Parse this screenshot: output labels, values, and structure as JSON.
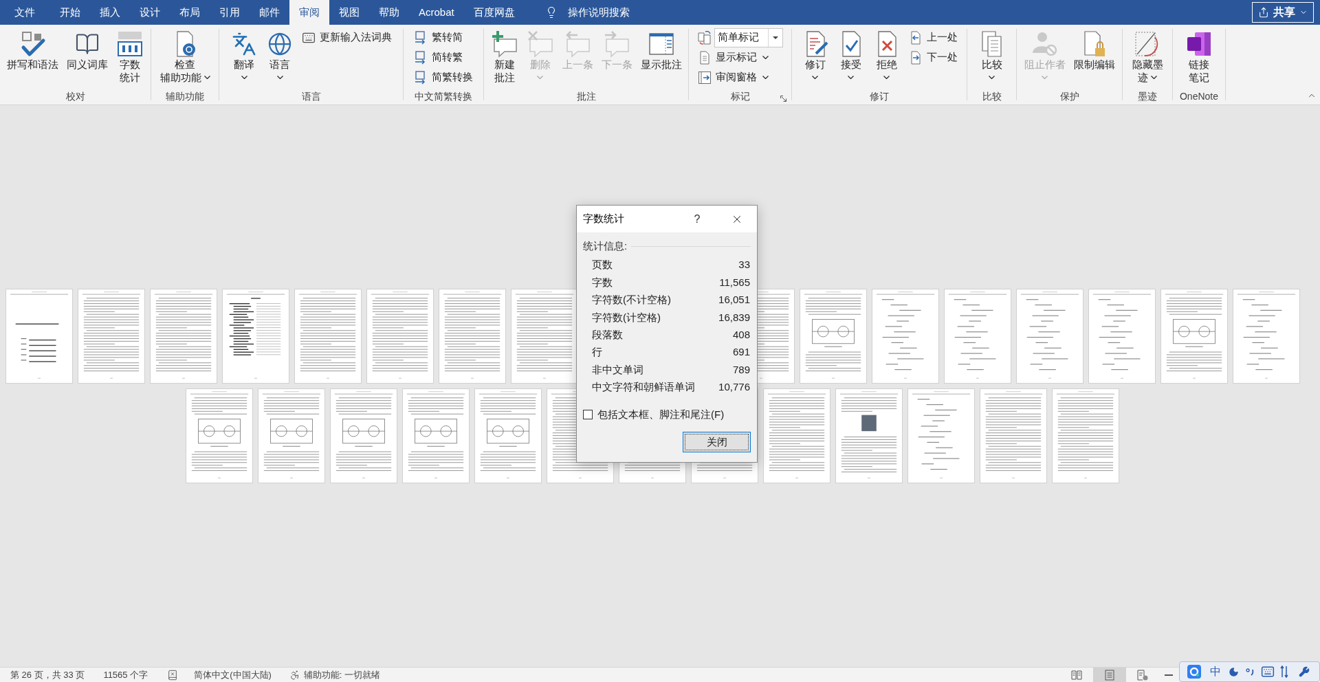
{
  "tabs": [
    {
      "label": "文件",
      "selected": false
    },
    {
      "label": "开始",
      "selected": false
    },
    {
      "label": "插入",
      "selected": false
    },
    {
      "label": "设计",
      "selected": false
    },
    {
      "label": "布局",
      "selected": false
    },
    {
      "label": "引用",
      "selected": false
    },
    {
      "label": "邮件",
      "selected": false
    },
    {
      "label": "审阅",
      "selected": true
    },
    {
      "label": "视图",
      "selected": false
    },
    {
      "label": "帮助",
      "selected": false
    },
    {
      "label": "Acrobat",
      "selected": false
    },
    {
      "label": "百度网盘",
      "selected": false
    }
  ],
  "tell_me": {
    "label": "操作说明搜索"
  },
  "share_button": {
    "label": "共享"
  },
  "ribbon": {
    "groups": [
      {
        "label": "校对",
        "launcher": false,
        "items": [
          {
            "kind": "large",
            "lines": [
              "拼写和语法"
            ],
            "disabled": false,
            "dropdown": false
          },
          {
            "kind": "large",
            "lines": [
              "同义词库"
            ],
            "disabled": false,
            "dropdown": false
          },
          {
            "kind": "large",
            "lines": [
              "字数",
              "统计"
            ],
            "disabled": false,
            "dropdown": false
          }
        ]
      },
      {
        "label": "辅助功能",
        "launcher": false,
        "items": [
          {
            "kind": "large",
            "lines": [
              "检查",
              "辅助功能"
            ],
            "disabled": false,
            "dropdown": true
          }
        ]
      },
      {
        "label": "语言",
        "launcher": false,
        "items": [
          {
            "kind": "large",
            "lines": [
              "翻译"
            ],
            "disabled": false,
            "dropdown": true
          },
          {
            "kind": "large",
            "lines": [
              "语言"
            ],
            "disabled": false,
            "dropdown": true
          },
          {
            "kind": "small",
            "lines": [
              "更新输入法词典"
            ],
            "disabled": false,
            "dropdown": false
          }
        ]
      },
      {
        "label": "中文简繁转换",
        "launcher": false,
        "items": [
          {
            "kind": "small",
            "lines": [
              "繁转简"
            ],
            "disabled": false,
            "dropdown": false
          },
          {
            "kind": "small",
            "lines": [
              "简转繁"
            ],
            "disabled": false,
            "dropdown": false
          },
          {
            "kind": "small",
            "lines": [
              "简繁转换"
            ],
            "disabled": false,
            "dropdown": false
          }
        ]
      },
      {
        "label": "批注",
        "launcher": false,
        "items": [
          {
            "kind": "large",
            "lines": [
              "新建",
              "批注"
            ],
            "disabled": false,
            "dropdown": false
          },
          {
            "kind": "large",
            "lines": [
              "删除"
            ],
            "disabled": true,
            "dropdown": true
          },
          {
            "kind": "large",
            "lines": [
              "上一条"
            ],
            "disabled": true,
            "dropdown": false
          },
          {
            "kind": "large",
            "lines": [
              "下一条"
            ],
            "disabled": true,
            "dropdown": false
          },
          {
            "kind": "large",
            "lines": [
              "显示批注"
            ],
            "disabled": false,
            "dropdown": false
          }
        ]
      },
      {
        "label": "标记",
        "launcher": true,
        "items": [
          {
            "kind": "combo",
            "lines": [
              "简单标记"
            ],
            "disabled": false,
            "dropdown": true
          },
          {
            "kind": "small",
            "lines": [
              "显示标记"
            ],
            "disabled": false,
            "dropdown": true
          },
          {
            "kind": "small",
            "lines": [
              "审阅窗格"
            ],
            "disabled": false,
            "dropdown": true
          }
        ]
      },
      {
        "label": "修订",
        "launcher": false,
        "items": [
          {
            "kind": "large",
            "lines": [
              "修订"
            ],
            "disabled": false,
            "dropdown": true
          },
          {
            "kind": "large",
            "lines": [
              "接受"
            ],
            "disabled": false,
            "dropdown": true
          },
          {
            "kind": "large",
            "lines": [
              "拒绝"
            ],
            "disabled": false,
            "dropdown": true
          },
          {
            "kind": "small",
            "lines": [
              "上一处"
            ],
            "disabled": false,
            "dropdown": false
          },
          {
            "kind": "small",
            "lines": [
              "下一处"
            ],
            "disabled": false,
            "dropdown": false
          }
        ]
      },
      {
        "label": "比较",
        "launcher": false,
        "items": [
          {
            "kind": "large",
            "lines": [
              "比较"
            ],
            "disabled": false,
            "dropdown": true
          }
        ]
      },
      {
        "label": "保护",
        "launcher": false,
        "items": [
          {
            "kind": "large",
            "lines": [
              "阻止作者"
            ],
            "disabled": true,
            "dropdown": true
          },
          {
            "kind": "large",
            "lines": [
              "限制编辑"
            ],
            "disabled": false,
            "dropdown": false
          }
        ]
      },
      {
        "label": "墨迹",
        "launcher": false,
        "items": [
          {
            "kind": "large",
            "lines": [
              "隐藏墨",
              "迹"
            ],
            "disabled": false,
            "dropdown": true
          }
        ]
      },
      {
        "label": "OneNote",
        "launcher": false,
        "items": [
          {
            "kind": "large",
            "lines": [
              "链接",
              "笔记"
            ],
            "disabled": false,
            "dropdown": false
          }
        ]
      }
    ]
  },
  "document": {
    "page_rows": [
      {
        "pages": [
          {
            "kind": "cover"
          },
          {
            "kind": "text"
          },
          {
            "kind": "text"
          },
          {
            "kind": "toc"
          },
          {
            "kind": "text"
          },
          {
            "kind": "text"
          },
          {
            "kind": "text"
          },
          {
            "kind": "text"
          },
          {
            "kind": "hidden"
          },
          {
            "kind": "hidden"
          },
          {
            "kind": "text"
          },
          {
            "kind": "figure"
          },
          {
            "kind": "formula"
          },
          {
            "kind": "formula"
          },
          {
            "kind": "formula"
          },
          {
            "kind": "formula"
          },
          {
            "kind": "figure"
          },
          {
            "kind": "formula"
          }
        ]
      },
      {
        "pages": [
          {
            "kind": "figure"
          },
          {
            "kind": "figure"
          },
          {
            "kind": "figure"
          },
          {
            "kind": "figure"
          },
          {
            "kind": "figure"
          },
          {
            "kind": "text"
          },
          {
            "kind": "text"
          },
          {
            "kind": "text"
          },
          {
            "kind": "text"
          },
          {
            "kind": "photo"
          },
          {
            "kind": "formula"
          },
          {
            "kind": "text"
          },
          {
            "kind": "text"
          }
        ]
      }
    ]
  },
  "dialog": {
    "title": "字数统计",
    "help": "?",
    "section": "统计信息:",
    "stats": [
      {
        "label": "页数",
        "value": "33"
      },
      {
        "label": "字数",
        "value": "11,565"
      },
      {
        "label": "字符数(不计空格)",
        "value": "16,051"
      },
      {
        "label": "字符数(计空格)",
        "value": "16,839"
      },
      {
        "label": "段落数",
        "value": "408"
      },
      {
        "label": "行",
        "value": "691"
      },
      {
        "label": "非中文单词",
        "value": "789"
      },
      {
        "label": "中文字符和朝鲜语单词",
        "value": "10,776"
      }
    ],
    "include_checkbox": {
      "label": "包括文本框、脚注和尾注(F)",
      "checked": false
    },
    "close_button": "关闭"
  },
  "status_bar": {
    "page": "第 26 页，共 33 页",
    "words": "11565 个字",
    "language": "简体中文(中国大陆)",
    "accessibility": "辅助功能: 一切就绪",
    "views": [
      {
        "selected": false
      },
      {
        "selected": true
      },
      {
        "selected": false
      }
    ]
  },
  "ime_toolbar": {
    "mode": "中"
  }
}
